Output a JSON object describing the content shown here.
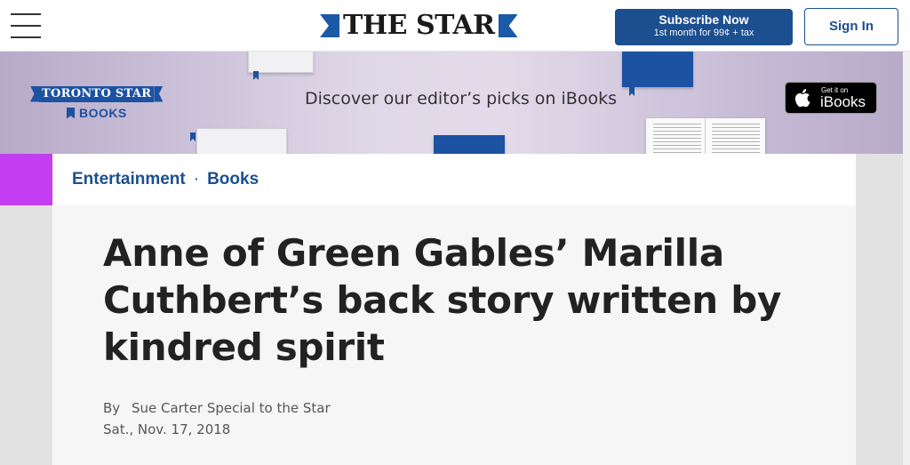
{
  "header": {
    "logo_text": "THE STAR",
    "subscribe_label": "Subscribe Now",
    "subscribe_sub": "1st month for 99¢ + tax",
    "signin_label": "Sign In"
  },
  "banner": {
    "brand_name": "TORONTO STAR",
    "brand_sub": "BOOKS",
    "headline": "Discover our editor’s picks on iBooks",
    "badge_small": "Get it on",
    "badge_big": "iBooks"
  },
  "breadcrumb": {
    "section": "Entertainment",
    "separator": "·",
    "subsection": "Books"
  },
  "article": {
    "headline": "Anne of Green Gables’ Marilla Cuthbert’s back story written by kindred spirit",
    "by_label": "By",
    "author": "Sue Carter Special to the Star",
    "date": "Sat., Nov. 17, 2018"
  },
  "colors": {
    "brand_blue": "#1b4f8f",
    "accent_purple": "#c33ef0",
    "banner_purple": "#b7aac9"
  }
}
